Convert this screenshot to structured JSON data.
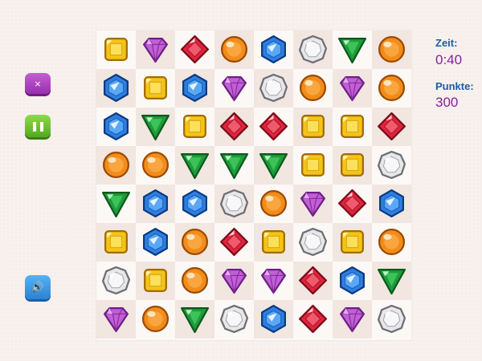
{
  "hud": {
    "time_label": "Zeit:",
    "time_value": "0:40",
    "score_label": "Punkte:",
    "score_value": "300"
  },
  "controls": {
    "close_icon": "×",
    "pause_icon": "❚❚",
    "sound_icon": "🔊"
  },
  "colors": {
    "label": "#1f5aa6",
    "value": "#8b1f9a",
    "close_button": "#b047c3",
    "pause_button": "#6cc233",
    "sound_button": "#3a98e6"
  },
  "gem_types": {
    "Y": "yellow-square-gem",
    "P": "purple-diamond-gem",
    "R": "red-rhombus-gem",
    "O": "orange-round-gem",
    "B": "blue-hexagon-gem",
    "W": "white-polygon-gem",
    "G": "green-triangle-gem"
  },
  "board": {
    "rows": 8,
    "cols": 8,
    "grid": [
      [
        "Y",
        "P",
        "R",
        "O",
        "B",
        "W",
        "G",
        "O"
      ],
      [
        "B",
        "Y",
        "B",
        "P",
        "W",
        "O",
        "P",
        "O"
      ],
      [
        "B",
        "G",
        "Y",
        "R",
        "R",
        "Y",
        "Y",
        "R"
      ],
      [
        "O",
        "O",
        "G",
        "G",
        "G",
        "Y",
        "Y",
        "W"
      ],
      [
        "G",
        "B",
        "B",
        "W",
        "O",
        "P",
        "R",
        "B"
      ],
      [
        "Y",
        "B",
        "O",
        "R",
        "Y",
        "W",
        "Y",
        "O"
      ],
      [
        "W",
        "Y",
        "O",
        "P",
        "P",
        "R",
        "B",
        "G"
      ],
      [
        "P",
        "O",
        "G",
        "W",
        "B",
        "R",
        "P",
        "W"
      ]
    ]
  }
}
